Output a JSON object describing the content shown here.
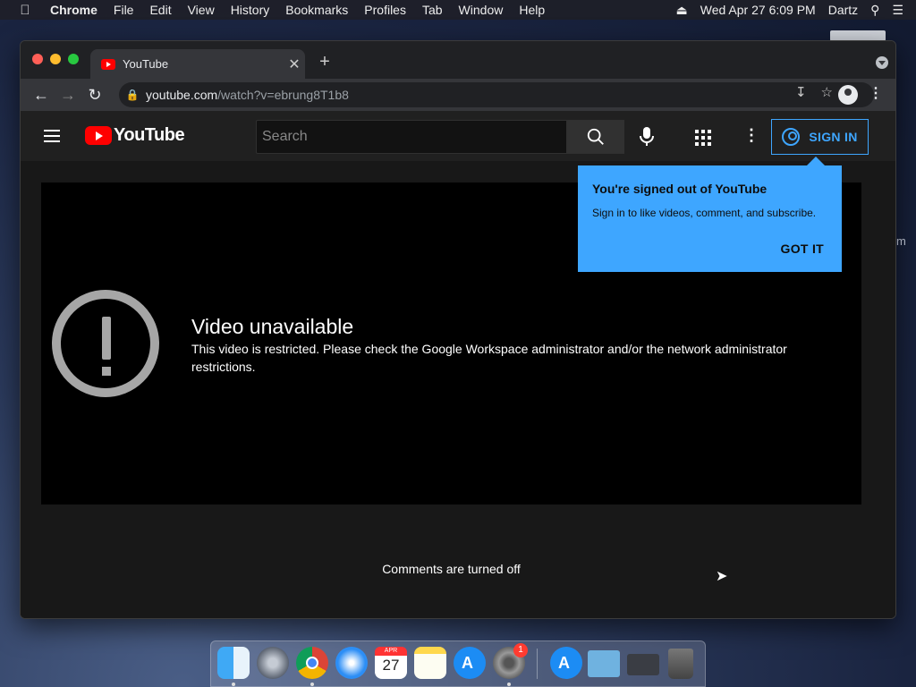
{
  "menubar": {
    "app": "Chrome",
    "items": [
      "File",
      "Edit",
      "View",
      "History",
      "Bookmarks",
      "Profiles",
      "Tab",
      "Window",
      "Help"
    ],
    "datetime": "Wed Apr 27  6:09 PM",
    "user": "Dartz"
  },
  "browser": {
    "tab_title": "YouTube",
    "url_host": "youtube.com",
    "url_path": "/watch?v=ebrung8T1b8"
  },
  "youtube": {
    "logo_text": "YouTube",
    "search_placeholder": "Search",
    "signin_label": "SIGN IN"
  },
  "tooltip": {
    "title": "You're signed out of YouTube",
    "body": "Sign in to like videos, comment, and subscribe.",
    "button": "GOT IT"
  },
  "player": {
    "error_title": "Video unavailable",
    "error_message": "This video is restricted. Please check the Google Workspace administrator and/or the network administrator restrictions."
  },
  "comments_status": "Comments are turned off",
  "dock": {
    "calendar_month": "APR",
    "calendar_day": "27",
    "settings_badge": "1"
  },
  "desktop": {
    "edge_letter": "m"
  }
}
